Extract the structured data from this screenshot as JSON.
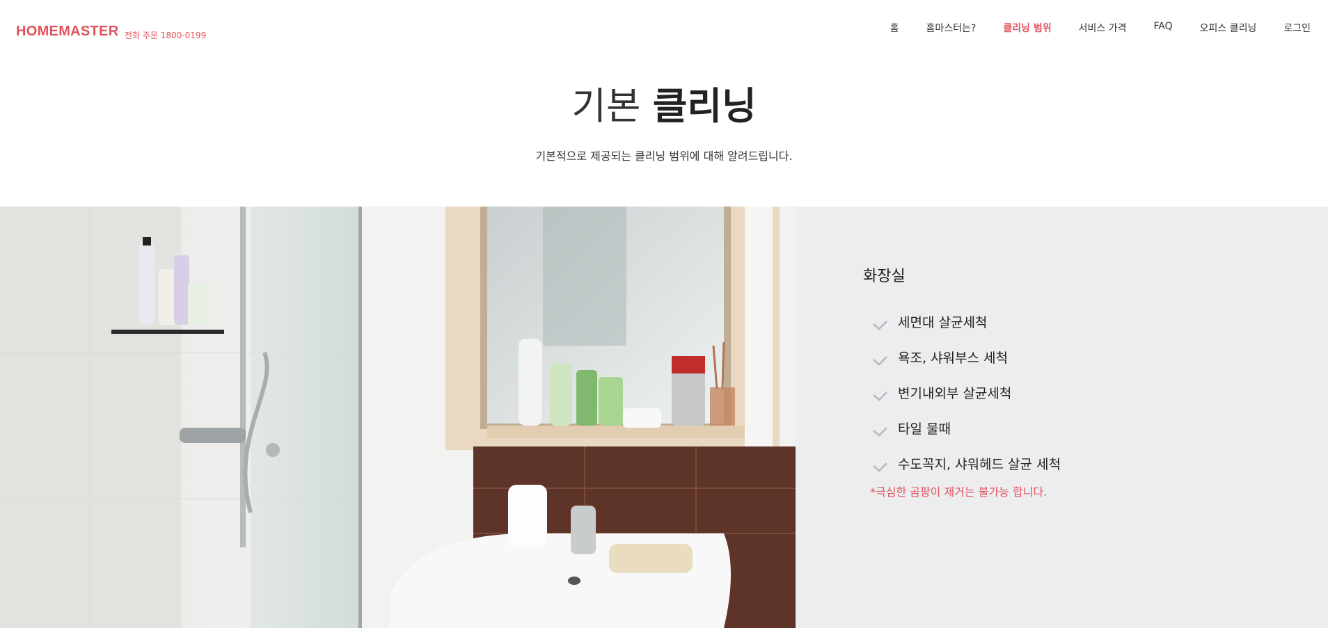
{
  "header": {
    "logo": "HOMEMASTER",
    "phone": "전화 주문 1800-0199",
    "nav": [
      {
        "label": "홈",
        "active": false
      },
      {
        "label": "홈마스터는?",
        "active": false
      },
      {
        "label": "클리닝 범위",
        "active": true
      },
      {
        "label": "서비스 가격",
        "active": false
      },
      {
        "label": "FAQ",
        "active": false
      },
      {
        "label": "오피스 클리닝",
        "active": false
      },
      {
        "label": "로그인",
        "active": false
      }
    ]
  },
  "hero": {
    "title_light": "기본",
    "title_bold": "클리닝",
    "subtitle": "기본적으로 제공되는 클리닝 범위에 대해 알려드립니다."
  },
  "section": {
    "title": "화장실",
    "items": [
      "세면대 살균세척",
      "욕조, 샤워부스 세척",
      "변기내외부 살균세척",
      "타일 물때",
      "수도꼭지, 샤워헤드 살균 세척"
    ],
    "note": "*극심한 곰팡이 제거는 불가능 합니다.",
    "check_icon": "check-icon"
  },
  "colors": {
    "accent": "#e0525a",
    "panel_bg": "#ededf0"
  }
}
